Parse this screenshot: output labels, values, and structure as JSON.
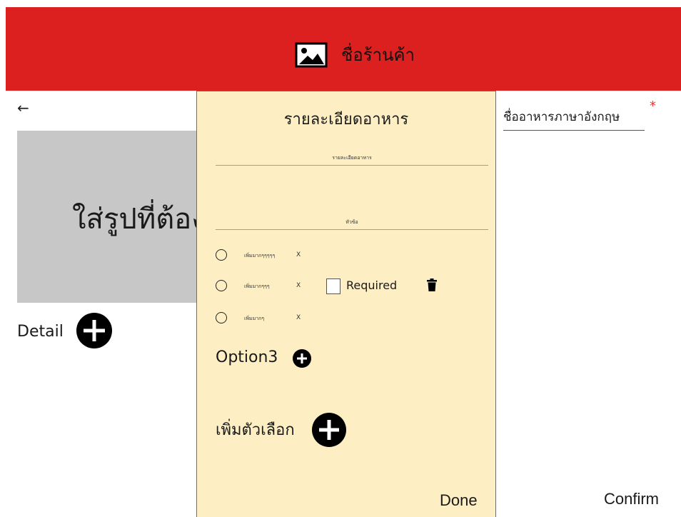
{
  "header": {
    "store_name": "ชื่อร้านค้า",
    "store_icon": "image-icon",
    "background_color": "#dc1f1f"
  },
  "page": {
    "back_icon": "arrow-left-icon",
    "back_glyph": "←",
    "image_placeholder_text": "ใส่รูปที่ต้อง",
    "detail_label": "Detail",
    "english_name_label": "ชื่ออาหารภาษาอังกฤษ",
    "required_marker": "*",
    "confirm_label": "Confirm"
  },
  "modal": {
    "title": "รายละเอียดอาหาร",
    "detail_field_caption": "รายละเอียดอาหาร",
    "topic_field_caption": "หัวข้อ",
    "options": [
      {
        "label": "เพิ่มมากๆๆๆๆๆ",
        "remove": "X"
      },
      {
        "label": "เพิ่มมากๆๆๆ",
        "remove": "X"
      },
      {
        "label": "เพิ่มมากๆ",
        "remove": "X"
      }
    ],
    "required_label": "Required",
    "option3_label": "Option3",
    "add_choice_label": "เพิ่มตัวเลือก",
    "done_label": "Done",
    "background_color": "#fdefc3"
  }
}
